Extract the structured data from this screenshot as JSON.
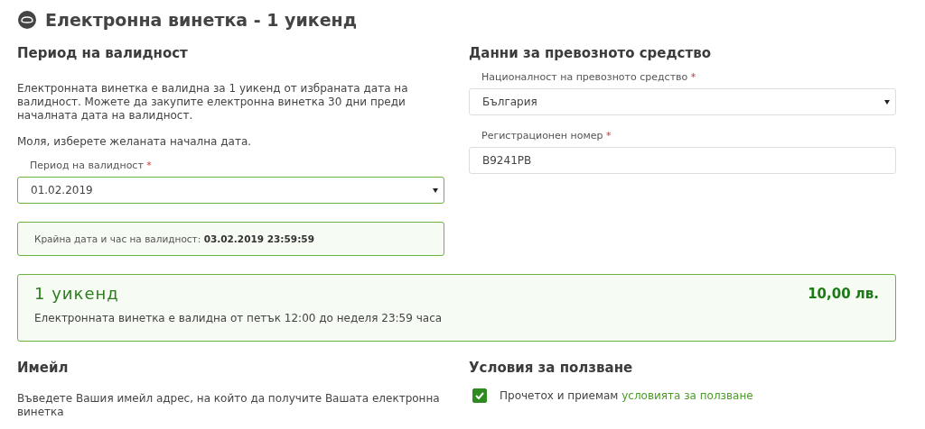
{
  "page_title": "Електронна винетка - 1 уикенд",
  "validity": {
    "heading": "Период на валидност",
    "description": "Електронната винетка е валидна за 1 уикенд от избраната дата на валидност. Можете да закупите електронна винетка 30 дни преди началната дата на валидност.",
    "prompt": "Моля, изберете желаната начална дата.",
    "field": {
      "label": "Период на валидност",
      "required_mark": "*",
      "value": "01.02.2019",
      "valid": true
    },
    "end_info": {
      "label": "Крайна дата и час на валидност:",
      "value": "03.02.2019 23:59:59"
    }
  },
  "vehicle": {
    "heading": "Данни за превозното средство",
    "fields": [
      {
        "kind": "select",
        "label": "Националност на превозното средство",
        "required_mark": "*",
        "value": "България"
      },
      {
        "kind": "text",
        "label": "Регистрационен номер",
        "required_mark": "*",
        "value": "В9241РВ"
      }
    ]
  },
  "summary": {
    "title": "1 уикенд",
    "price": "10,00 лв.",
    "note": "Електронната винетка е валидна от петък 12:00 до неделя 23:59 часа"
  },
  "email": {
    "heading": "Имейл",
    "description": "Въведете Вашия имейл адрес, на който да получите Вашата електронна винетка"
  },
  "terms": {
    "heading": "Условия за ползване",
    "checked": true,
    "text": "Прочетох и приемам",
    "link": "условията за ползване"
  }
}
